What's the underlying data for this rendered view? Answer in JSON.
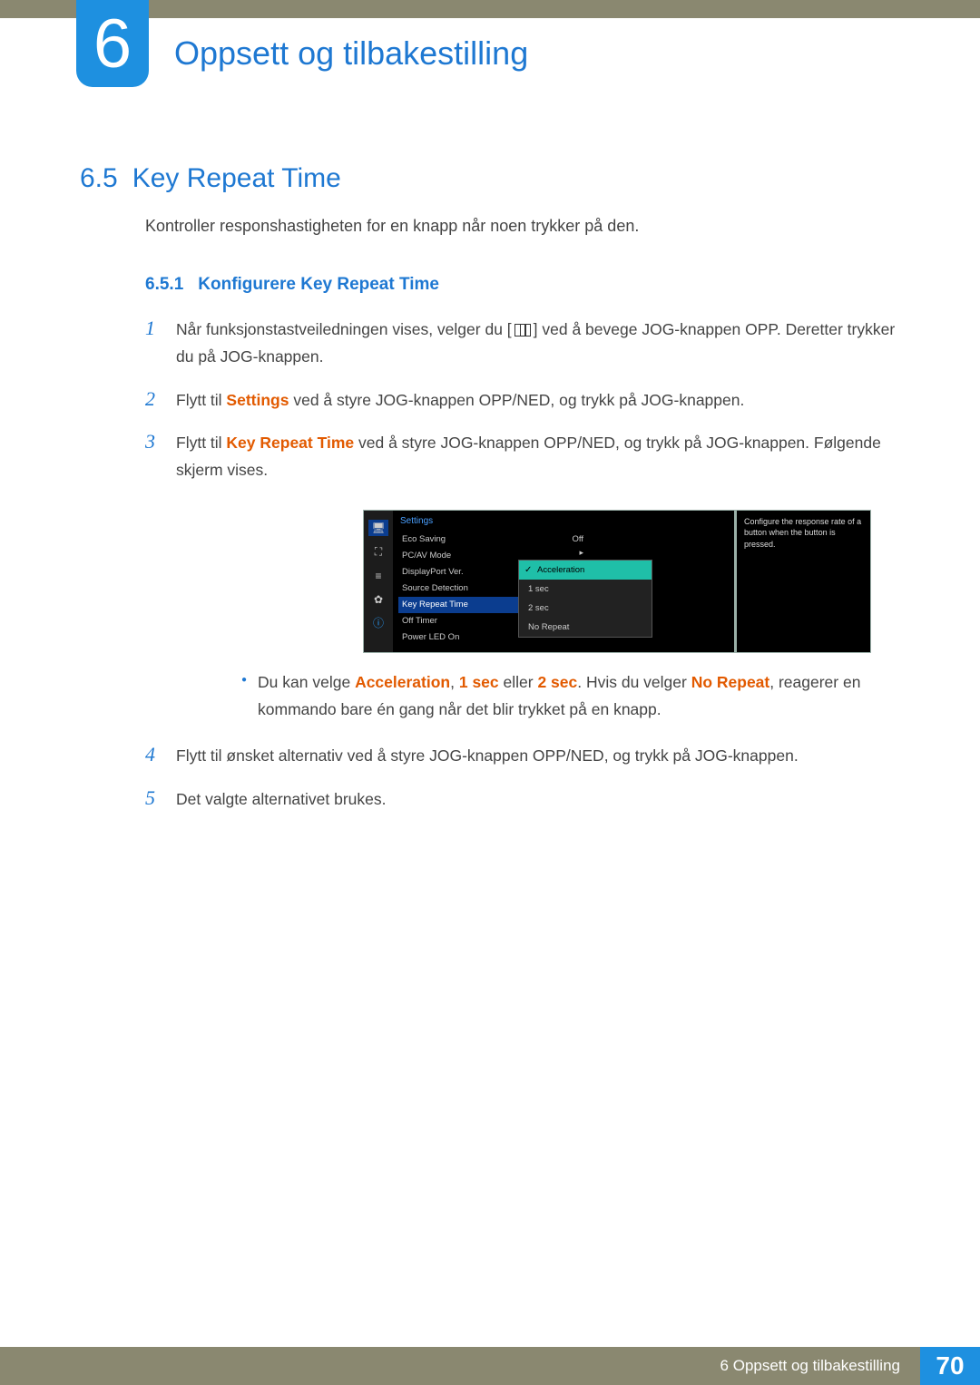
{
  "chapter": {
    "number": "6",
    "title": "Oppsett og tilbakestilling"
  },
  "section": {
    "number": "6.5",
    "title": "Key Repeat Time"
  },
  "intro": "Kontroller responshastigheten for en knapp når noen trykker på den.",
  "subsection": {
    "number": "6.5.1",
    "title": "Konfigurere Key Repeat Time"
  },
  "steps": {
    "s1a": "Når funksjonstastveiledningen vises, velger du [",
    "s1b": "] ved å bevege JOG-knappen OPP. Deretter trykker du på JOG-knappen.",
    "s2a": "Flytt til ",
    "s2_bold": "Settings",
    "s2b": " ved å styre JOG-knappen OPP/NED, og trykk på JOG-knappen.",
    "s3a": "Flytt til ",
    "s3_bold": "Key Repeat Time",
    "s3b": " ved å styre JOG-knappen OPP/NED, og trykk på JOG-knappen. Følgende skjerm vises.",
    "s4": "Flytt til ønsket alternativ ved å styre JOG-knappen OPP/NED, og trykk på JOG-knappen.",
    "s5": "Det valgte alternativet brukes."
  },
  "bullet": {
    "a": "Du kan velge ",
    "b1": "Acceleration",
    "comma": ", ",
    "b2": "1 sec",
    "or": " eller ",
    "b3": "2 sec",
    "c": ". Hvis du velger ",
    "b4": "No Repeat",
    "d": ", reagerer en kommando bare én gang når det blir trykket på en knapp."
  },
  "osd": {
    "title": "Settings",
    "items": [
      "Eco Saving",
      "PC/AV Mode",
      "DisplayPort Ver.",
      "Source Detection",
      "Key Repeat Time",
      "Off Timer",
      "Power LED On"
    ],
    "value_off": "Off",
    "value_arrow": "▸",
    "popup": [
      "Acceleration",
      "1 sec",
      "2 sec",
      "No Repeat"
    ],
    "desc": "Configure the response rate of a button when the button is pressed."
  },
  "footer": {
    "text": "6 Oppsett og tilbakestilling",
    "page": "70"
  },
  "nums": {
    "n1": "1",
    "n2": "2",
    "n3": "3",
    "n4": "4",
    "n5": "5"
  }
}
